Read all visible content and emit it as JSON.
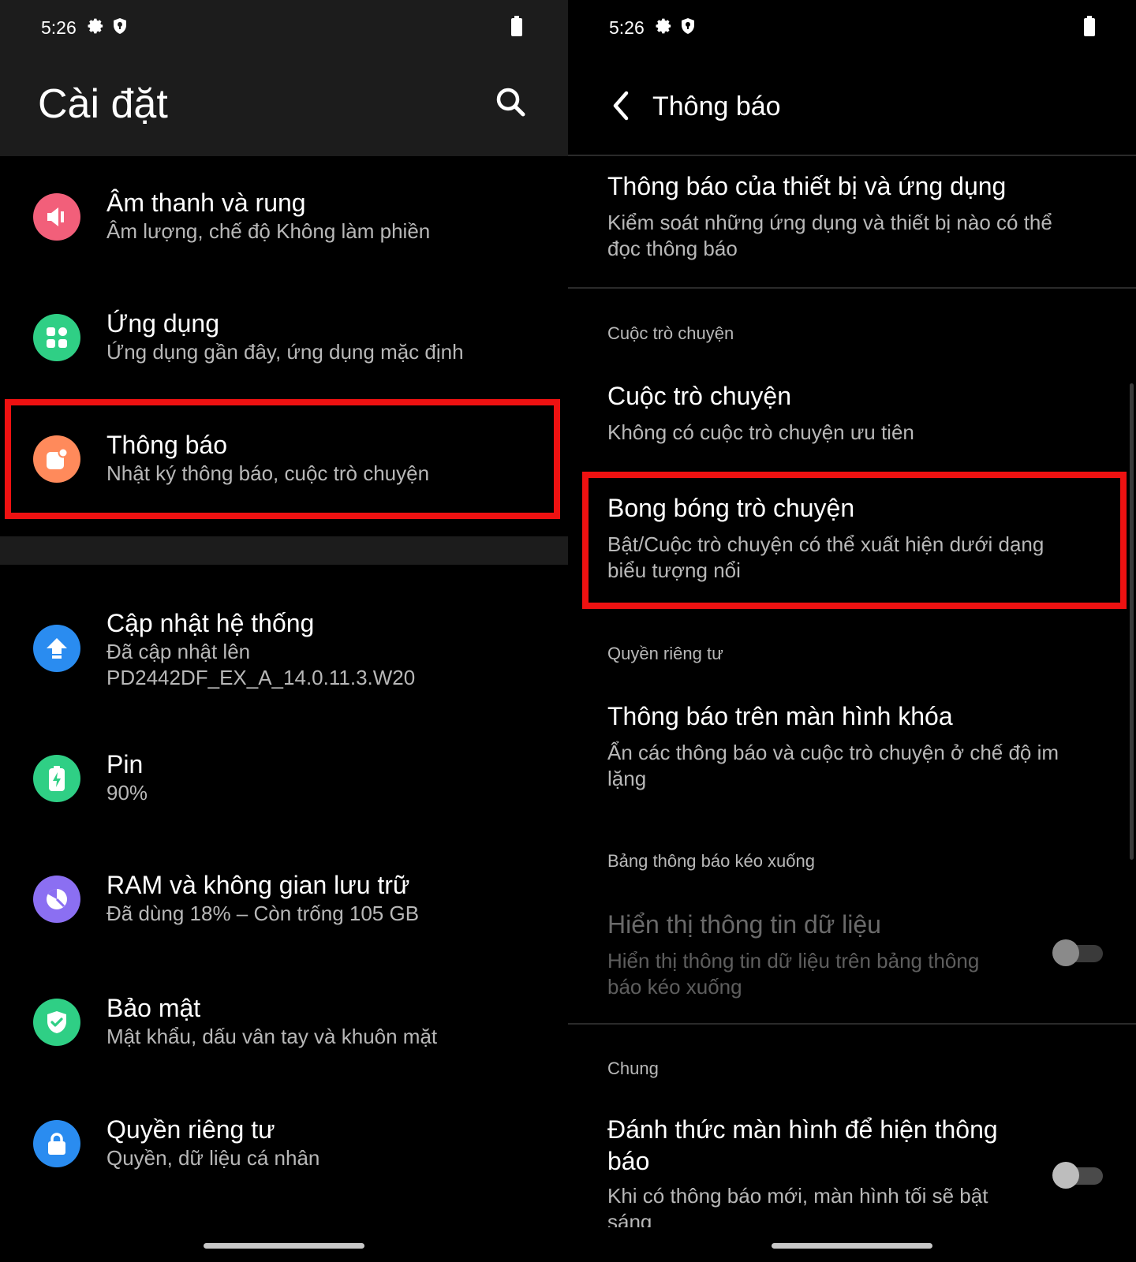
{
  "left": {
    "status": {
      "time": "5:26"
    },
    "header": {
      "title": "Cài đặt"
    },
    "items": [
      {
        "title": "Âm thanh và rung",
        "subtitle": "Âm lượng, chế độ Không làm phiền",
        "icon": "speaker-icon",
        "color": "#f25f7a"
      },
      {
        "title": "Ứng dụng",
        "subtitle": "Ứng dụng gần đây, ứng dụng mặc định",
        "icon": "apps-grid-icon",
        "color": "#2fcf85"
      },
      {
        "title": "Thông báo",
        "subtitle": "Nhật ký thông báo, cuộc trò chuyện",
        "icon": "notification-icon",
        "color": "#ff8a5b"
      },
      {
        "title": "Cập nhật hệ thống",
        "subtitle": "Đã cập nhật lên\nPD2442DF_EX_A_14.0.11.3.W20",
        "icon": "update-icon",
        "color": "#2a8cf0"
      },
      {
        "title": "Pin",
        "subtitle": "90%",
        "icon": "battery-icon",
        "color": "#2fcf85"
      },
      {
        "title": "RAM và không gian lưu trữ",
        "subtitle": "Đã dùng 18% – Còn trống 105 GB",
        "icon": "storage-icon",
        "color": "#8b6ff2"
      },
      {
        "title": "Bảo mật",
        "subtitle": "Mật khẩu, dấu vân tay và khuôn mặt",
        "icon": "security-shield-icon",
        "color": "#2fcf85"
      },
      {
        "title": "Quyền riêng tư",
        "subtitle": "Quyền, dữ liệu cá nhân",
        "icon": "privacy-lock-icon",
        "color": "#2a8cf0"
      }
    ]
  },
  "right": {
    "status": {
      "time": "5:26"
    },
    "header": {
      "title": "Thông báo"
    },
    "device_apps": {
      "title": "Thông báo của thiết bị và ứng dụng",
      "subtitle": "Kiểm soát những ứng dụng và thiết bị nào có thể\nđọc thông báo"
    },
    "cat_conversation": "Cuộc trò chuyện",
    "conversation": {
      "title": "Cuộc trò chuyện",
      "subtitle": "Không có cuộc trò chuyện ưu tiên"
    },
    "bubbles": {
      "title": "Bong bóng trò chuyện",
      "subtitle": "Bật/Cuộc trò chuyện có thể xuất hiện dưới dạng\nbiểu tượng nổi"
    },
    "cat_privacy": "Quyền riêng tư",
    "lockscreen": {
      "title": "Thông báo trên màn hình khóa",
      "subtitle": "Ẩn các thông báo và cuộc trò chuyện ở chế độ im\nlặng"
    },
    "cat_shade": "Bảng thông báo kéo xuống",
    "data_info": {
      "title": "Hiển thị thông tin dữ liệu",
      "subtitle": "Hiển thị thông tin dữ liệu trên bảng thông\nbáo kéo xuống",
      "enabled": false
    },
    "cat_general": "Chung",
    "wake_screen": {
      "title": "Đánh thức màn hình để hiện thông\nbáo",
      "subtitle": "Khi có thông báo mới, màn hình tối sẽ bật\nsáng",
      "enabled": false
    }
  }
}
